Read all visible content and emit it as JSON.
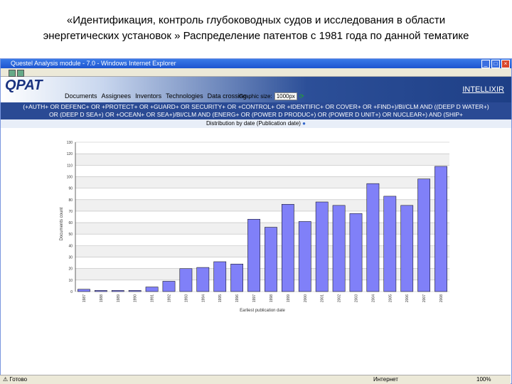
{
  "slide": {
    "title_line1": "«Идентификация, контроль глубоководных судов и исследования в области",
    "title_line2": "энергетических установок » Распределение патентов с 1981 года по данной тематике"
  },
  "window": {
    "title": "Questel Analysis module - 7.0 - Windows Internet Explorer"
  },
  "app": {
    "logo": "QPAT",
    "brand": "INTELLIXIR",
    "nav": [
      "Documents",
      "Assignees",
      "Inventors",
      "Technologies",
      "Data crossing"
    ],
    "graphic_size_label": "Graphic size:",
    "graphic_size_value": "1000px",
    "query_line1": "(+AUTH+ OR DEFENC+ OR +PROTECT+ OR +GUARD+ OR SECURITY+ OR +CONTROL+ OR +IDENTIFIC+ OR COVER+ OR +FIND+)/BI/CLM AND ((DEEP D WATER+)",
    "query_line2": "OR (DEEP D SEA+) OR +OCEAN+ OR SEA+)/BI/CLM AND (ENERG+ OR (POWER D PRODUC+) OR (POWER D UNIT+) OR NUCLEAR+) AND (SHIP+",
    "distribution": "Distribution by date (Publication date)"
  },
  "status": {
    "left": "Готово",
    "zone": "Интернет",
    "zoom": "100%"
  },
  "chart_data": {
    "type": "bar",
    "title": "Distribution by date (Publication date)",
    "xlabel": "Earliest publication date",
    "ylabel": "Documents count",
    "ylim": [
      0,
      130
    ],
    "yticks": [
      0,
      10,
      20,
      30,
      40,
      50,
      60,
      70,
      80,
      90,
      100,
      110,
      120,
      130
    ],
    "categories": [
      "1987",
      "1988",
      "1989",
      "1990",
      "1991",
      "1992",
      "1993",
      "1994",
      "1995",
      "1996",
      "1997",
      "1998",
      "1999",
      "2000",
      "2001",
      "2002",
      "2003",
      "2004",
      "2005",
      "2006",
      "2007",
      "2008"
    ],
    "values": [
      2,
      1,
      1,
      1,
      4,
      9,
      20,
      21,
      26,
      24,
      63,
      56,
      76,
      61,
      78,
      75,
      68,
      94,
      83,
      75,
      98,
      109
    ],
    "bar_color": "#8080f8"
  }
}
